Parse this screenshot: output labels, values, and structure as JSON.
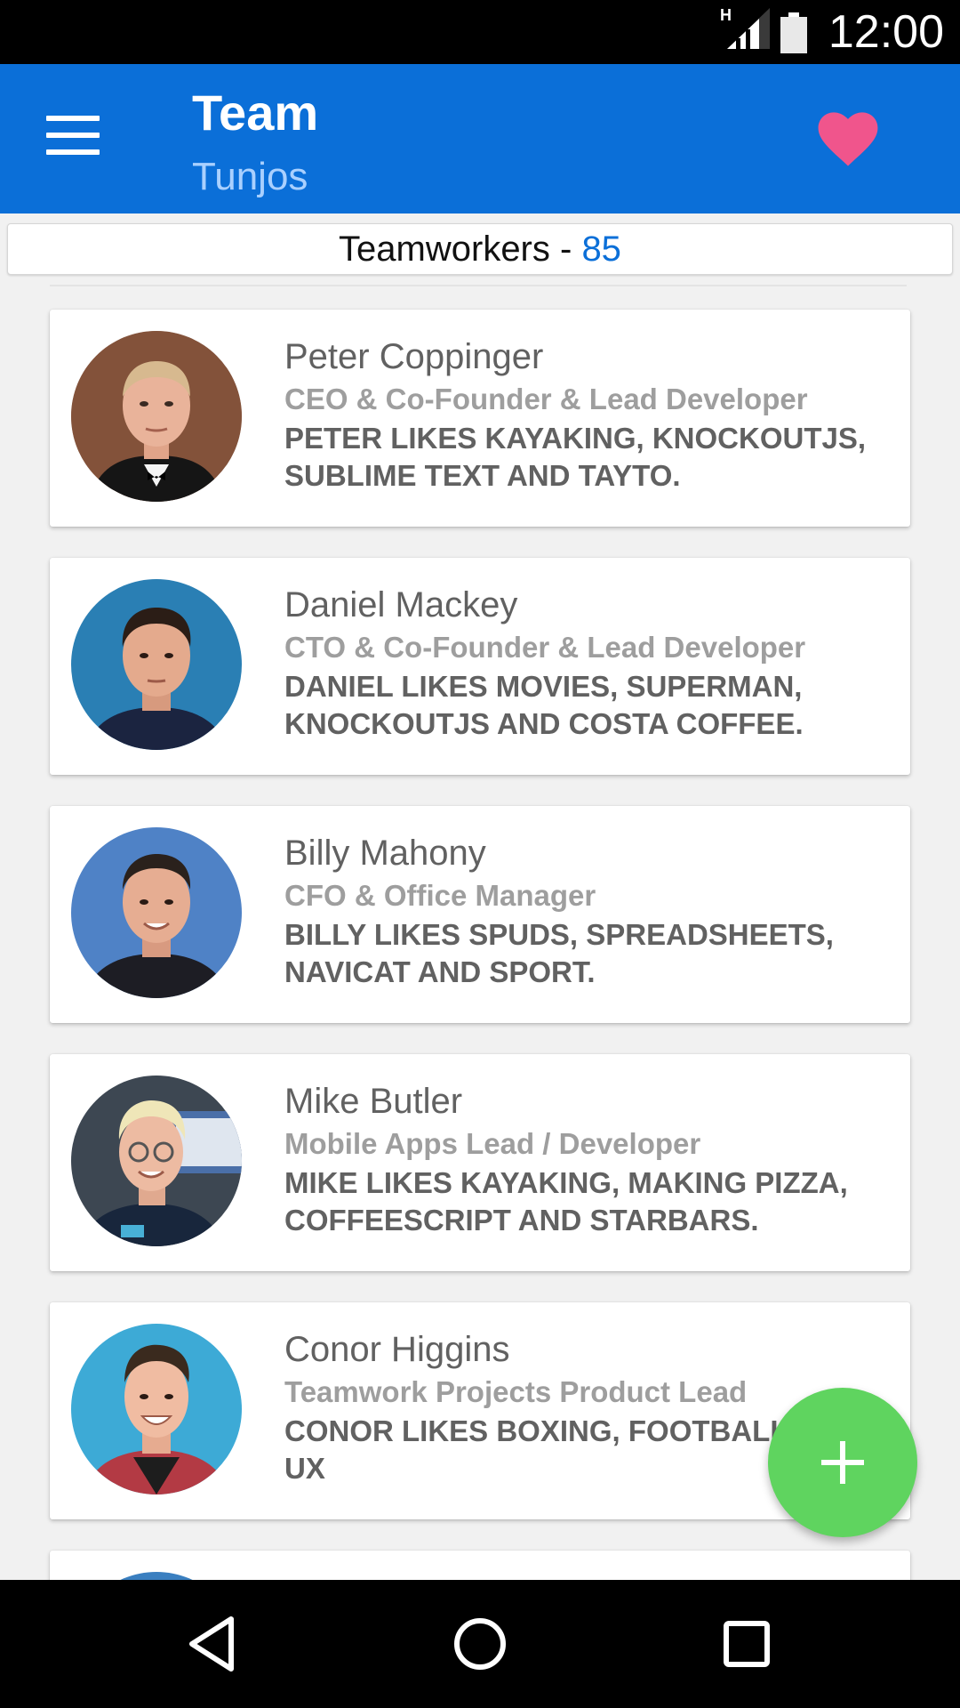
{
  "status_bar": {
    "network_type": "H",
    "time": "12:00",
    "icons": [
      "signal-icon",
      "battery-icon"
    ]
  },
  "app_bar": {
    "title": "Team",
    "subtitle": "Tunjos",
    "icons": [
      "menu-icon",
      "heart-icon"
    ],
    "colors": {
      "background": "#0b6fd8",
      "subtitle": "#a9d0ff",
      "heart": "#f0558c"
    }
  },
  "team_count": {
    "label": "Teamworkers - ",
    "value": "85"
  },
  "members": [
    {
      "name": "Peter Coppinger",
      "role": "CEO & Co-Founder & Lead Developer",
      "likes": "PETER LIKES KAYAKING, KNOCKOUTJS, SUBLIME TEXT AND TAYTO."
    },
    {
      "name": "Daniel Mackey",
      "role": "CTO & Co-Founder & Lead Developer",
      "likes": "DANIEL LIKES MOVIES, SUPERMAN, KNOCKOUTJS AND COSTA COFFEE."
    },
    {
      "name": "Billy Mahony",
      "role": "CFO & Office Manager",
      "likes": "BILLY LIKES SPUDS, SPREADSHEETS, NAVICAT AND SPORT."
    },
    {
      "name": "Mike Butler",
      "role": "Mobile Apps Lead / Developer",
      "likes": "MIKE LIKES KAYAKING, MAKING PIZZA, COFFEESCRIPT AND STARBARS."
    },
    {
      "name": "Conor Higgins",
      "role": "Teamwork Projects Product Lead",
      "likes": "CONOR LIKES BOXING, FOOTBALL AND UX"
    }
  ],
  "fab": {
    "icon": "plus-icon",
    "color": "#5fd45f"
  },
  "nav_bar": {
    "icons": [
      "back-icon",
      "home-icon",
      "recents-icon"
    ]
  }
}
